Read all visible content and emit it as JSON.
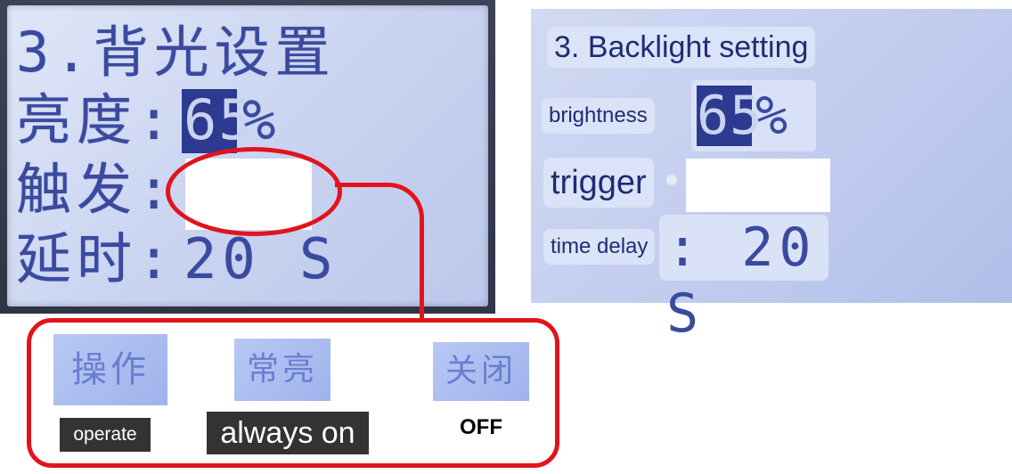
{
  "chinese_screen": {
    "title": "3.背光设置",
    "rows": [
      {
        "label": "亮度:",
        "value": "65",
        "unit": "%"
      },
      {
        "label": "触发:",
        "value": ""
      },
      {
        "label": "延时:",
        "value": "20 S"
      }
    ]
  },
  "trigger_options": [
    {
      "lcd_text": "操作",
      "caption": "operate"
    },
    {
      "lcd_text": "常亮",
      "caption": "always on"
    },
    {
      "lcd_text": "关闭",
      "caption": "OFF"
    }
  ],
  "english_screen": {
    "title": "3. Backlight setting",
    "brightness_label": "brightness",
    "brightness_value": "65",
    "brightness_unit": "%",
    "trigger_label": "trigger",
    "time_delay_label": "time delay",
    "time_delay_value": ": 20 S"
  },
  "colors": {
    "callout_red": "#e1141c",
    "lcd_blue": "#3a4a9e",
    "lcd_bg": "#c9d3f0"
  }
}
